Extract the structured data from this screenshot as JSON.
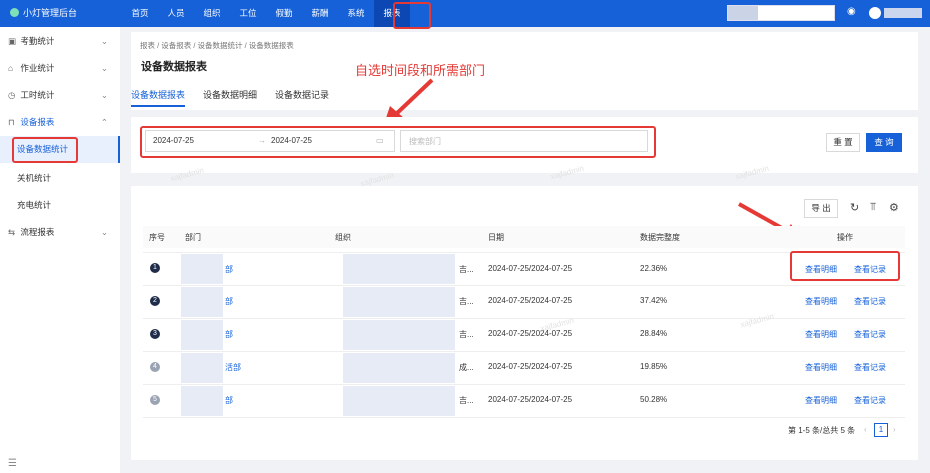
{
  "app": {
    "title": "小灯管理后台"
  },
  "topnav": [
    "首页",
    "人员",
    "组织",
    "工位",
    "假勤",
    "薪酬",
    "系统",
    "报表"
  ],
  "sidebar": {
    "items": [
      "考勤统计",
      "作业统计",
      "工时统计",
      "设备报表",
      "流程报表"
    ],
    "subitems": [
      "设备数据统计",
      "关机统计",
      "充电统计"
    ]
  },
  "breadcrumb": "报表 / 设备报表 / 设备数据统计 / 设备数据报表",
  "page": {
    "title": "设备数据报表",
    "tabs": [
      "设备数据报表",
      "设备数据明细",
      "设备数据记录"
    ]
  },
  "annotations": {
    "callout": "自选时间段和所需部门"
  },
  "filter": {
    "start": "2024-07-25",
    "end": "2024-07-25",
    "dept_placeholder": "搜索部门",
    "reset": "重 置",
    "query": "查 询"
  },
  "toolbar": {
    "export": "导 出"
  },
  "table": {
    "headers": [
      "序号",
      "部门",
      "组织",
      "日期",
      "数据完整度",
      "操作"
    ],
    "rows": [
      {
        "rank": "1",
        "dept": "部",
        "org_tail": "吉...",
        "date": "2024-07-25/2024-07-25",
        "completeness": "22.36%"
      },
      {
        "rank": "2",
        "dept": "部",
        "org_tail": "吉...",
        "date": "2024-07-25/2024-07-25",
        "completeness": "37.42%"
      },
      {
        "rank": "3",
        "dept": "部",
        "org_tail": "吉...",
        "date": "2024-07-25/2024-07-25",
        "completeness": "28.84%"
      },
      {
        "rank": "4",
        "dept": "活部",
        "org_tail": "成...",
        "date": "2024-07-25/2024-07-25",
        "completeness": "19.85%"
      },
      {
        "rank": "5",
        "dept": "部",
        "org_tail": "吉...",
        "date": "2024-07-25/2024-07-25",
        "completeness": "50.28%"
      }
    ],
    "action_detail": "查看明细",
    "action_record": "查看记录"
  },
  "pagination": {
    "summary": "第 1-5 条/总共 5 条",
    "current": "1"
  },
  "watermark": "xajfadmin",
  "colors": {
    "primary": "#1661d8",
    "annotation": "#e53935"
  }
}
